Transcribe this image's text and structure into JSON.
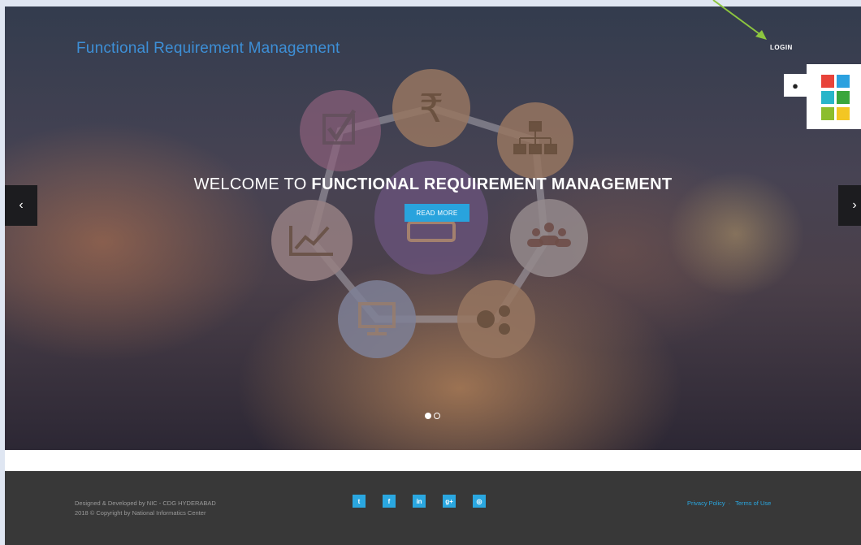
{
  "header": {
    "brand": "Functional Requirement Management",
    "login_label": "LOGIN"
  },
  "theme_switcher": {
    "icon": "droplet-icon",
    "swatches": [
      "#e8433a",
      "#2ba1df",
      "#28b5c9",
      "#3aa63c",
      "#8cbd2d",
      "#f3c623"
    ]
  },
  "slider": {
    "welcome_prefix": "WELCOME TO ",
    "welcome_bold": "FUNCTIONAL REQUIREMENT MANAGEMENT",
    "read_more_label": "READ MORE",
    "prev_glyph": "‹",
    "next_glyph": "›",
    "active_slide": 1,
    "slide_count": 2,
    "diagram_icons": [
      "rupee-icon",
      "hierarchy-icon",
      "people-icon",
      "gears-icon",
      "monitor-icon",
      "chart-line-icon",
      "checkbox-icon",
      "laptop-icon"
    ],
    "rupee_glyph": "₹"
  },
  "footer": {
    "credit_line1": "Designed & Developed by NIC - CDG HYDERABAD",
    "credit_line2": "2018 © Copyright by National Informatics Center",
    "socials": [
      {
        "name": "twitter-icon",
        "glyph": "t"
      },
      {
        "name": "facebook-icon",
        "glyph": "f"
      },
      {
        "name": "linkedin-icon",
        "glyph": "in"
      },
      {
        "name": "google-plus-icon",
        "glyph": "g+"
      },
      {
        "name": "instagram-icon",
        "glyph": "◎"
      }
    ],
    "privacy_label": "Privacy Policy",
    "terms_label": "Terms of Use"
  },
  "colors": {
    "accent": "#29a3dd",
    "brand_text": "#3d8fd6",
    "footer_bg": "#383838"
  }
}
